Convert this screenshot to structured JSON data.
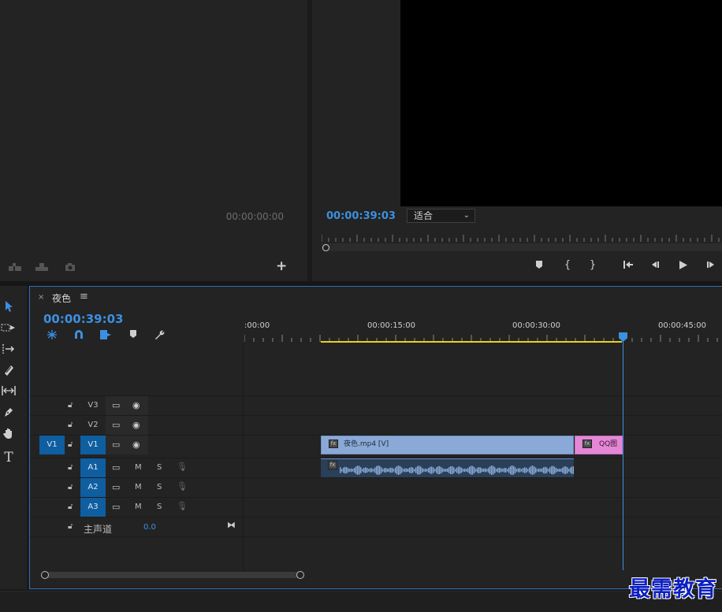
{
  "source": {
    "timecode": "00:00:00:00",
    "icons": [
      "insert-icon",
      "overwrite-icon",
      "camera-icon"
    ],
    "add_label": "+"
  },
  "program": {
    "timecode": "00:00:39:03",
    "fit_value": "适合",
    "controls": [
      "add-marker",
      "mark-in",
      "mark-out",
      "go-to-in",
      "step-back",
      "play",
      "step-forward"
    ]
  },
  "tools": [
    "selection-icon",
    "track-select-icon",
    "ripple-edit-icon",
    "razor-icon",
    "slip-icon",
    "pen-icon",
    "hand-icon",
    "type-icon"
  ],
  "timeline": {
    "close": "×",
    "title": "夜色",
    "menu": "≡",
    "timecode": "00:00:39:03",
    "ruler_labels": [
      ":00:00",
      "00:00:15:00",
      "00:00:30:00",
      "00:00:45:00"
    ],
    "video_tracks": [
      {
        "name": "V3",
        "active": false
      },
      {
        "name": "V2",
        "active": false
      },
      {
        "name": "V1",
        "active": true,
        "source": "V1"
      }
    ],
    "audio_tracks": [
      {
        "name": "A1",
        "m": "M",
        "s": "S"
      },
      {
        "name": "A2",
        "m": "M",
        "s": "S"
      },
      {
        "name": "A3",
        "m": "M",
        "s": "S"
      }
    ],
    "master": {
      "label": "主声道",
      "value": "0.0"
    },
    "clips": {
      "video_main": "夜色.mp4 [V]",
      "video_qq": "QQ图",
      "fx": "fx"
    }
  },
  "watermark": "最需教育",
  "colors": {
    "accent": "#3d8fe0",
    "work_area": "#e8d21a",
    "video_clip": "#8aa9d6",
    "image_clip": "#e487d7"
  }
}
